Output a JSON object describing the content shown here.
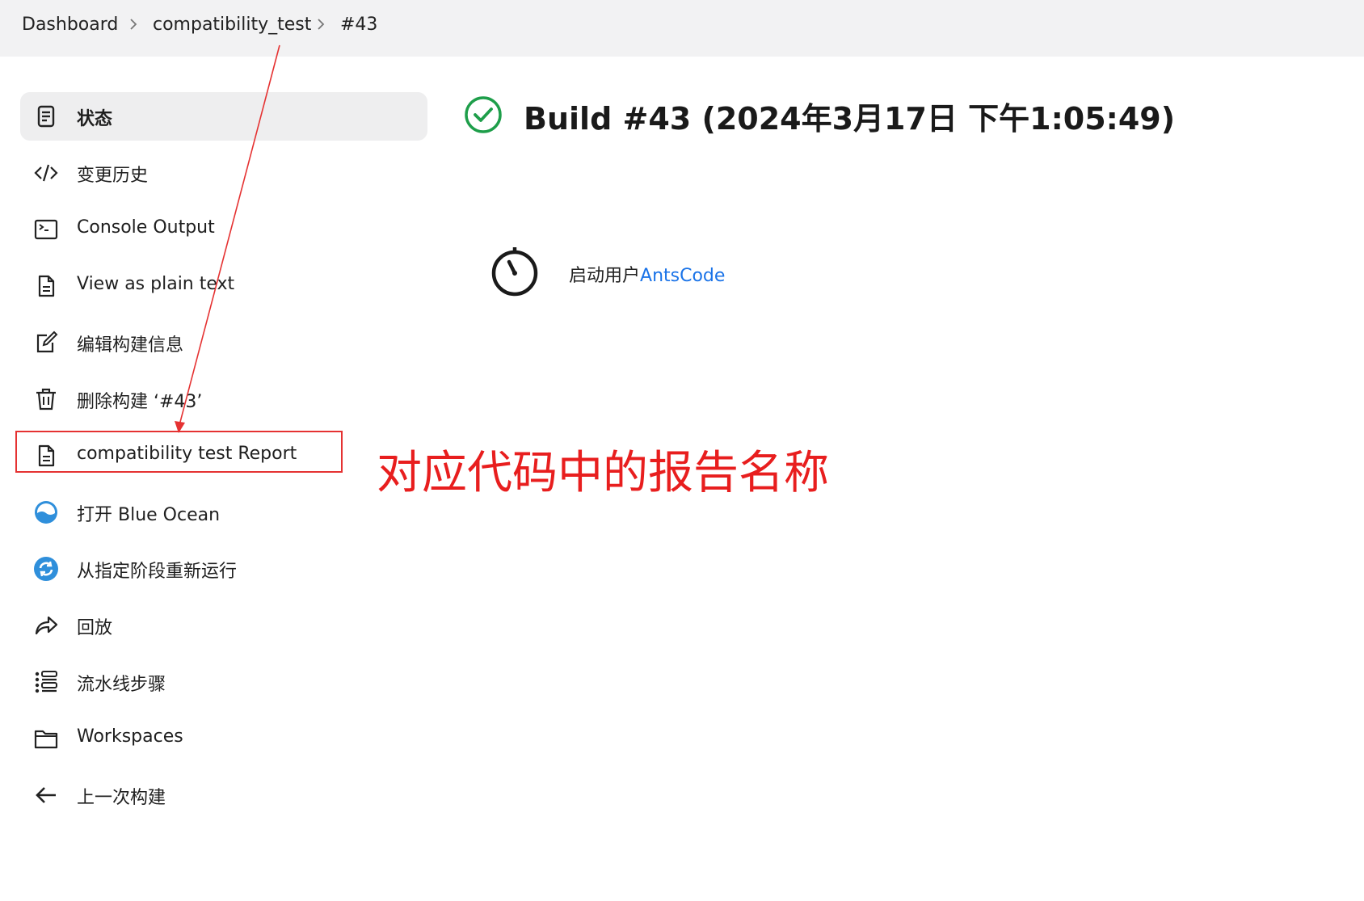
{
  "breadcrumb": {
    "items": [
      "Dashboard",
      "compatibility_test",
      "#43"
    ]
  },
  "sidebar": {
    "items": [
      {
        "label": "状态",
        "icon": "document-icon",
        "active": true
      },
      {
        "label": "变更历史",
        "icon": "code-icon"
      },
      {
        "label": "Console Output",
        "icon": "terminal-icon"
      },
      {
        "label": "View as plain text",
        "icon": "file-text-icon"
      },
      {
        "label": "编辑构建信息",
        "icon": "edit-icon"
      },
      {
        "label": "删除构建 ‘#43’",
        "icon": "trash-icon"
      },
      {
        "label": "compatibility test Report",
        "icon": "file-text-icon"
      },
      {
        "label": "打开 Blue Ocean",
        "icon": "blue-ocean-icon"
      },
      {
        "label": "从指定阶段重新运行",
        "icon": "restart-icon"
      },
      {
        "label": "回放",
        "icon": "replay-icon"
      },
      {
        "label": "流水线步骤",
        "icon": "list-icon"
      },
      {
        "label": "Workspaces",
        "icon": "folder-icon"
      },
      {
        "label": "上一次构建",
        "icon": "arrow-left-icon"
      }
    ]
  },
  "main": {
    "title": "Build #43 (2024年3月17日 下午1:05:49)",
    "status_icon": "success-check-icon",
    "started_by_prefix": "启动用户",
    "started_by_user": "AntsCode"
  },
  "annotation": {
    "text": "对应代码中的报告名称",
    "color": "#e81e1e"
  },
  "colors": {
    "success": "#1e9e4a",
    "link": "#1a73e8",
    "blue_ocean": "#2f8fdb",
    "annotation": "#e53232"
  }
}
